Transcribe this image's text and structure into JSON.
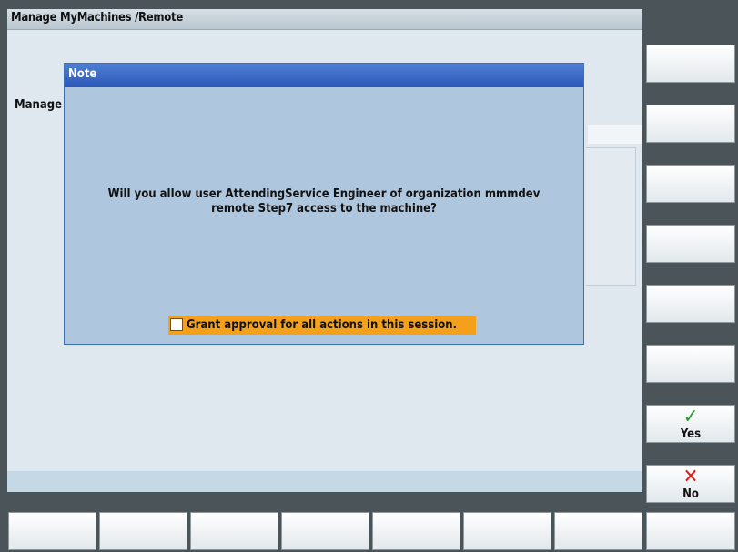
{
  "window": {
    "title": "Manage MyMachines /Remote"
  },
  "background": {
    "label": "Manage"
  },
  "dialog": {
    "title": "Note",
    "message_line1": "Will  you allow user AttendingService Engineer of organization mmmdev",
    "message_line2": "remote Step7 access to the machine?",
    "approval_checkbox": {
      "label": "Grant approval for all actions in this session.",
      "checked": false
    }
  },
  "softkeys_right": [
    {
      "label": "",
      "icon": ""
    },
    {
      "label": "",
      "icon": ""
    },
    {
      "label": "",
      "icon": ""
    },
    {
      "label": "",
      "icon": ""
    },
    {
      "label": "",
      "icon": ""
    },
    {
      "label": "",
      "icon": ""
    },
    {
      "label": "Yes",
      "icon": "check-icon"
    },
    {
      "label": "No",
      "icon": "cross-icon"
    }
  ],
  "softkeys_bottom": [
    "",
    "",
    "",
    "",
    "",
    "",
    "",
    ""
  ],
  "colors": {
    "dialog_title": "#2c58b8",
    "dialog_body": "#aec7de",
    "approval_highlight": "#f5a01a",
    "yes_icon": "#2c9a2c",
    "no_icon": "#e01818"
  }
}
